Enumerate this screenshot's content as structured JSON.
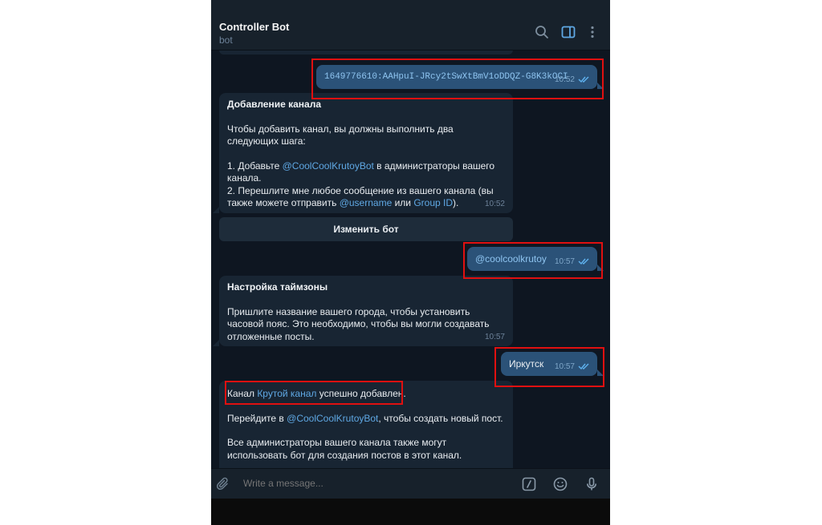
{
  "header": {
    "title": "Controller Bot",
    "subtitle": "bot"
  },
  "messages": {
    "token": {
      "text": "1649776610:AAHpuI-JRcy2tSwXtBmV1oDDQZ-G8K3kOCI",
      "time": "10:52"
    },
    "add_channel": {
      "title": "Добавление канала",
      "intro": "Чтобы добавить канал, вы должны выполнить два следующих шага:",
      "step1_prefix": "1. Добавьте ",
      "step1_link": "@CoolCoolKrutoyBot",
      "step1_suffix": " в администраторы вашего канала.",
      "step2_prefix": "2. Перешлите мне любое сообщение из вашего канала (вы также можете отправить ",
      "step2_link1": "@username",
      "step2_mid": " или ",
      "step2_link2": "Group ID",
      "step2_suffix": ").",
      "time": "10:52"
    },
    "change_bot_button": "Изменить бот",
    "username": {
      "text": "@coolcoolkrutoy",
      "time": "10:57"
    },
    "timezone": {
      "title": "Настройка таймзоны",
      "body": "Пришлите название вашего города, чтобы установить часовой пояс. Это необходимо, чтобы вы могли создавать отложенные посты.",
      "time": "10:57"
    },
    "city": {
      "text": "Иркутск",
      "time": "10:57"
    },
    "success": {
      "line1_prefix": "Канал ",
      "line1_link": "Крутой канал",
      "line1_suffix": " успешно добавлен.",
      "line2_prefix": "Перейдите в ",
      "line2_link": "@CoolCoolKrutoyBot",
      "line2_suffix": ", чтобы создать новый пост.",
      "line3": "Все администраторы вашего канала также могут использовать бот для создания постов в этот канал."
    }
  },
  "composer": {
    "placeholder": "Write a message..."
  },
  "icons": {
    "search": "search-icon",
    "sidebar": "sidebar-panel-icon",
    "more": "more-vertical-icon",
    "attach": "paperclip-icon",
    "commands": "slash-commands-icon",
    "emoji": "emoji-icon",
    "mic": "microphone-icon"
  },
  "colors": {
    "highlight": "#e01010",
    "outgoing_bubble": "#2b5278",
    "incoming_bubble": "#182533",
    "link": "#5fa8e4"
  }
}
